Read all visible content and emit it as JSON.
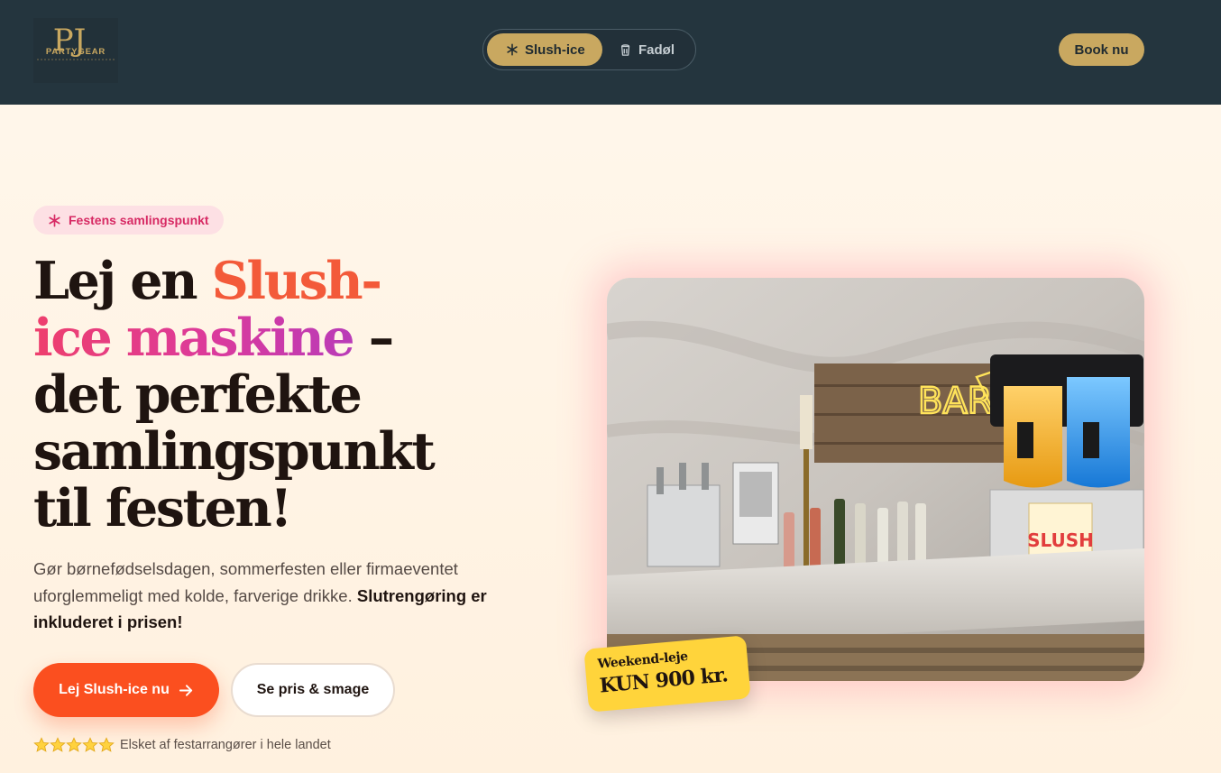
{
  "header": {
    "logo_text": "PARTYGEAR",
    "logo_letters": "PJ",
    "nav": [
      {
        "label": "Slush-ice",
        "icon": "snowflake-icon",
        "active": true
      },
      {
        "label": "Fadøl",
        "icon": "beer-icon",
        "active": false
      }
    ],
    "book_label": "Book nu"
  },
  "hero": {
    "badge": "Festens samlingspunkt",
    "headline": {
      "part1": "Lej en ",
      "accent1": "Slush-",
      "accent2": "ice maskine",
      "part2": " –",
      "line3": "det perfekte",
      "line4": "samlingspunkt",
      "line5": "til festen!"
    },
    "description": "Gør børnefødselsdagen, sommerfesten eller firmaeventet uforglemmeligt med kolde, farverige drikke. ",
    "description_bold": "Slutrengøring er inkluderet i prisen!",
    "cta_primary": "Lej Slush-ice nu",
    "cta_secondary": "Se pris & smage",
    "rating_text": "Elsket af festarrangører i hele landet",
    "rating_stars": 5,
    "photo_sign": "BAR",
    "sticker_top": "Weekend-leje",
    "sticker_price": "KUN 900 kr."
  },
  "colors": {
    "header_bg": "#24353e",
    "gold": "#c9a860",
    "cta": "#fb4f1f",
    "badge_bg": "#fde0e4",
    "badge_text": "#d72a64",
    "sticker": "#ffd43b"
  }
}
